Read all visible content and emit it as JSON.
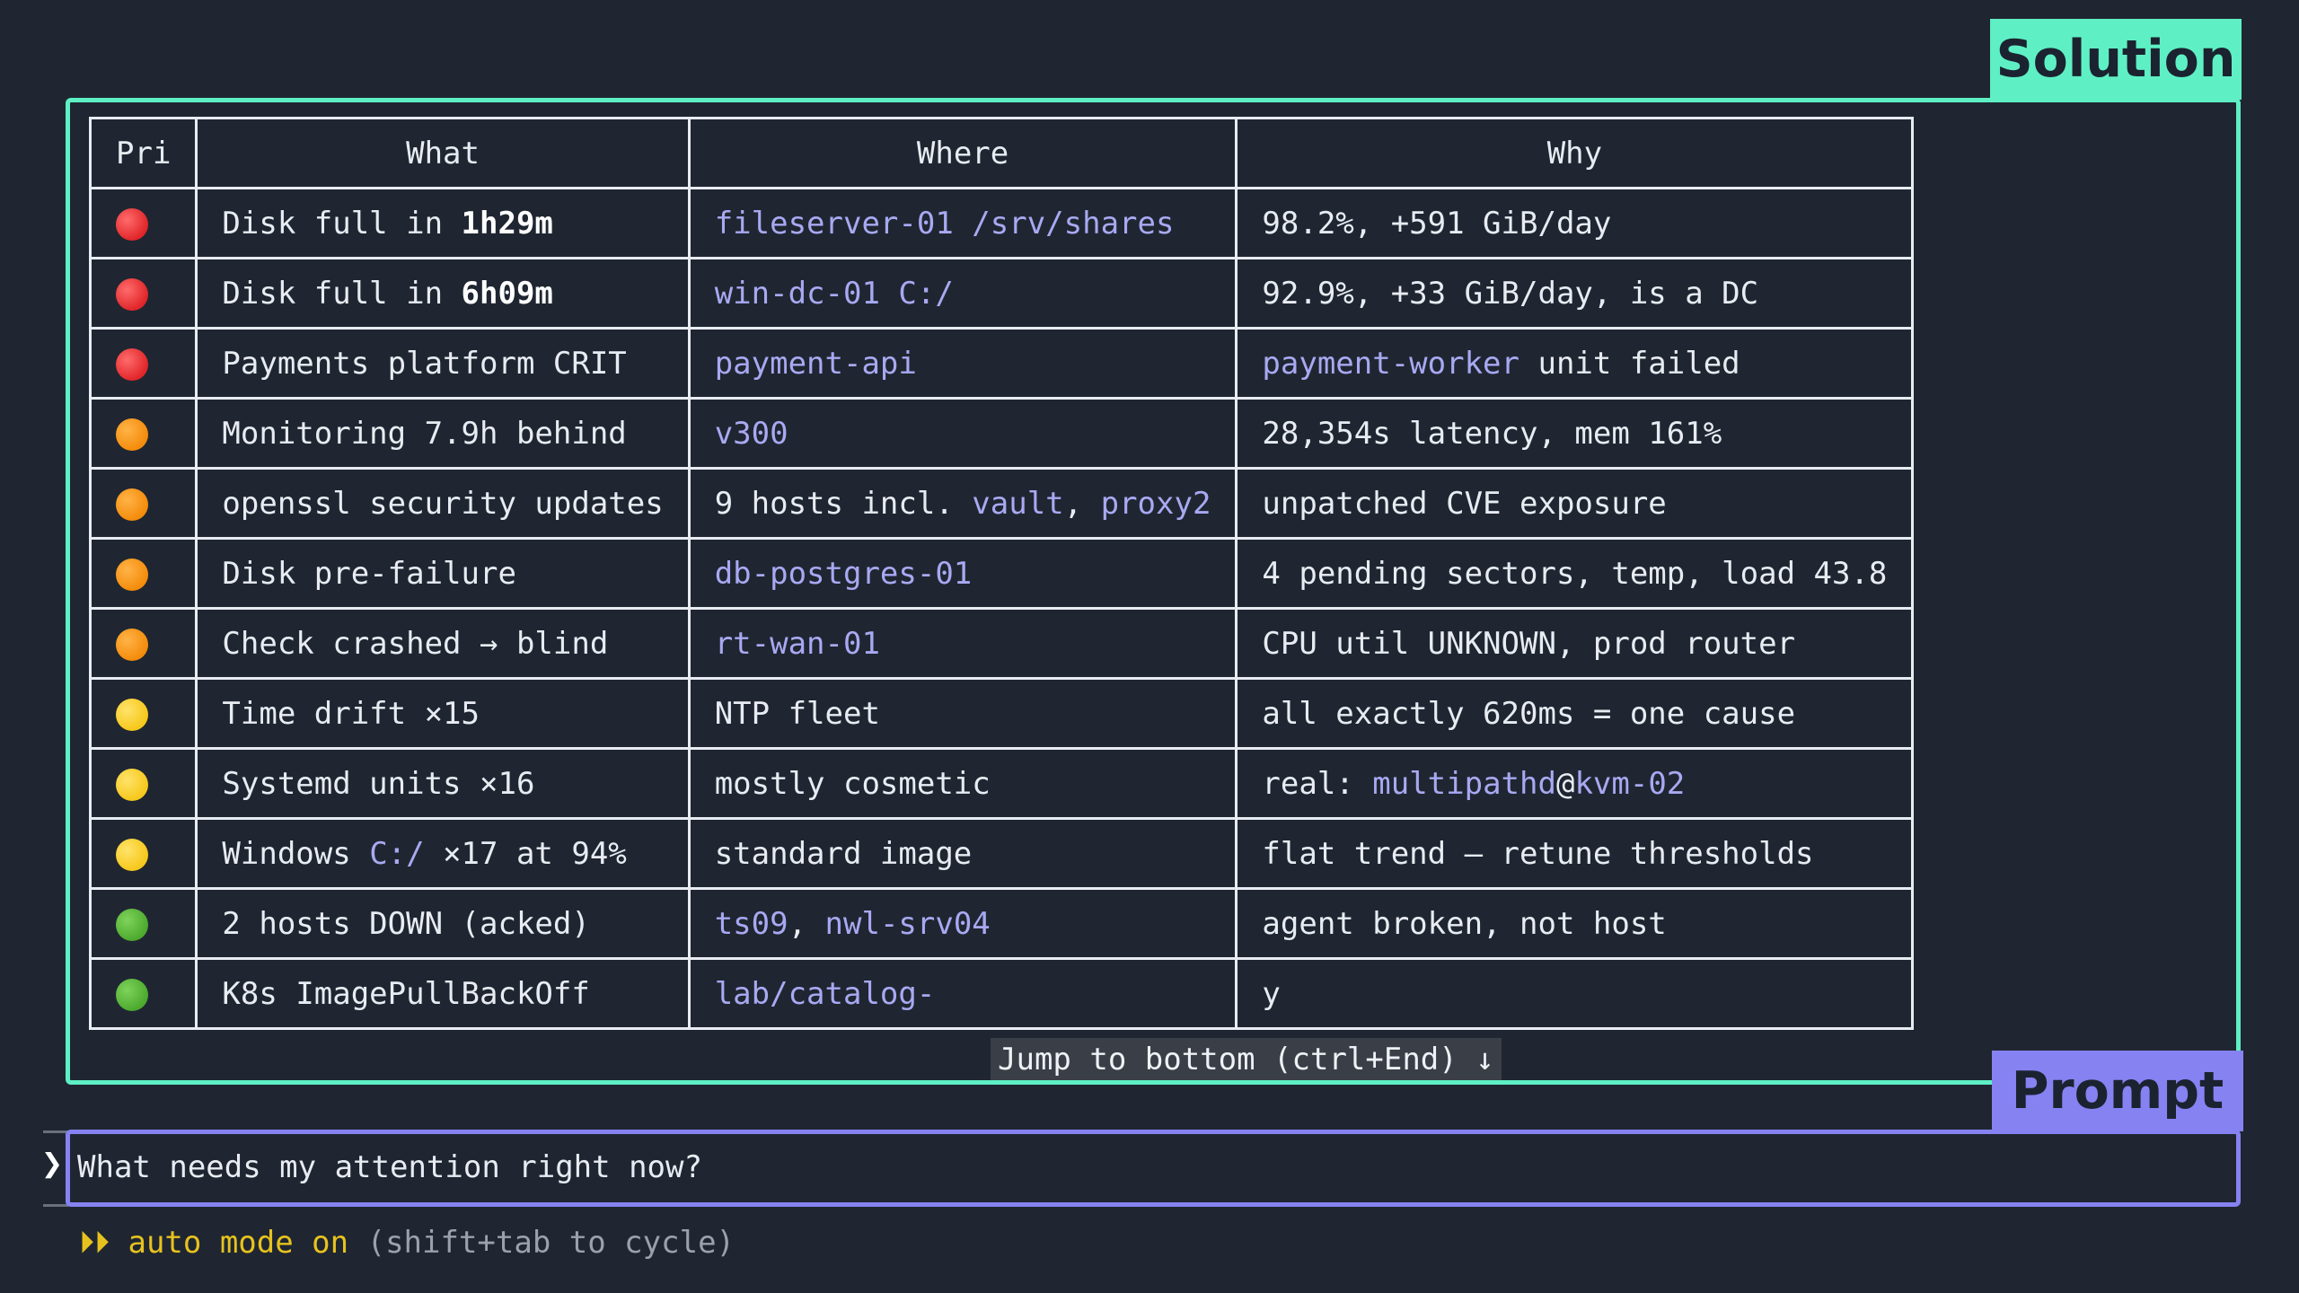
{
  "labels": {
    "solution": "Solution",
    "prompt": "Prompt"
  },
  "table": {
    "headers": [
      "Pri",
      "What",
      "Where",
      "Why"
    ],
    "rows": [
      {
        "pri": "red",
        "what": [
          {
            "t": "Disk full in "
          },
          {
            "t": "1h29m",
            "s": "bold"
          }
        ],
        "where": [
          {
            "t": "fileserver-01 /srv/shares",
            "s": "host"
          }
        ],
        "why": [
          {
            "t": "98.2%, +591 GiB/day"
          }
        ]
      },
      {
        "pri": "red",
        "what": [
          {
            "t": "Disk full in "
          },
          {
            "t": "6h09m",
            "s": "bold"
          }
        ],
        "where": [
          {
            "t": "win-dc-01 C:/",
            "s": "host"
          }
        ],
        "why": [
          {
            "t": "92.9%, +33 GiB/day, is a DC"
          }
        ]
      },
      {
        "pri": "red",
        "what": [
          {
            "t": "Payments platform CRIT"
          }
        ],
        "where": [
          {
            "t": "payment-api",
            "s": "host"
          }
        ],
        "why": [
          {
            "t": "payment-worker",
            "s": "host"
          },
          {
            "t": " unit failed"
          }
        ]
      },
      {
        "pri": "orange",
        "what": [
          {
            "t": "Monitoring 7.9h behind"
          }
        ],
        "where": [
          {
            "t": "v300",
            "s": "host"
          }
        ],
        "why": [
          {
            "t": "28,354s latency, mem 161%"
          }
        ]
      },
      {
        "pri": "orange",
        "what": [
          {
            "t": "openssl security updates"
          }
        ],
        "where": [
          {
            "t": "9 hosts incl. "
          },
          {
            "t": "vault",
            "s": "host"
          },
          {
            "t": ", "
          },
          {
            "t": "proxy2",
            "s": "host"
          }
        ],
        "why": [
          {
            "t": "unpatched CVE exposure"
          }
        ]
      },
      {
        "pri": "orange",
        "what": [
          {
            "t": "Disk pre-failure"
          }
        ],
        "where": [
          {
            "t": "db-postgres-01",
            "s": "host"
          }
        ],
        "why": [
          {
            "t": "4 pending sectors, temp, load 43.8"
          }
        ]
      },
      {
        "pri": "orange",
        "what": [
          {
            "t": "Check crashed → blind"
          }
        ],
        "where": [
          {
            "t": "rt-wan-01",
            "s": "host"
          }
        ],
        "why": [
          {
            "t": "CPU util UNKNOWN, prod router"
          }
        ]
      },
      {
        "pri": "yellow",
        "what": [
          {
            "t": "Time drift ×15"
          }
        ],
        "where": [
          {
            "t": "NTP fleet"
          }
        ],
        "why": [
          {
            "t": "all exactly 620ms = one cause"
          }
        ]
      },
      {
        "pri": "yellow",
        "what": [
          {
            "t": "Systemd units ×16"
          }
        ],
        "where": [
          {
            "t": "mostly cosmetic"
          }
        ],
        "why": [
          {
            "t": "real: "
          },
          {
            "t": "multipathd",
            "s": "host"
          },
          {
            "t": "@"
          },
          {
            "t": "kvm-02",
            "s": "host"
          }
        ]
      },
      {
        "pri": "yellow",
        "what": [
          {
            "t": "Windows "
          },
          {
            "t": "C:/",
            "s": "host"
          },
          {
            "t": " ×17 at 94%"
          }
        ],
        "where": [
          {
            "t": "standard image"
          }
        ],
        "why": [
          {
            "t": "flat trend — retune thresholds"
          }
        ]
      },
      {
        "pri": "green",
        "what": [
          {
            "t": "2 hosts DOWN (acked)"
          }
        ],
        "where": [
          {
            "t": "ts09",
            "s": "host"
          },
          {
            "t": ", "
          },
          {
            "t": "nwl-srv04",
            "s": "host"
          }
        ],
        "why": [
          {
            "t": "agent broken, not host"
          }
        ]
      },
      {
        "pri": "green",
        "what": [
          {
            "t": "K8s ImagePullBackOff"
          }
        ],
        "where": [
          {
            "t": "lab/catalog-",
            "s": "host"
          }
        ],
        "why": [
          {
            "t": "y"
          }
        ]
      }
    ]
  },
  "jump_button": {
    "label": "Jump to bottom (ctrl+End) ↓"
  },
  "prompt": {
    "caret": "❯",
    "text": "What needs my attention right now?"
  },
  "mode": {
    "arrows": "⏵⏵",
    "label": "auto mode on",
    "hint": "(shift+tab to cycle)"
  },
  "colors": {
    "solution_accent": "#5ef0c4",
    "prompt_accent": "#8682f2",
    "host_text": "#a8a9f2",
    "background": "#1f2631"
  }
}
